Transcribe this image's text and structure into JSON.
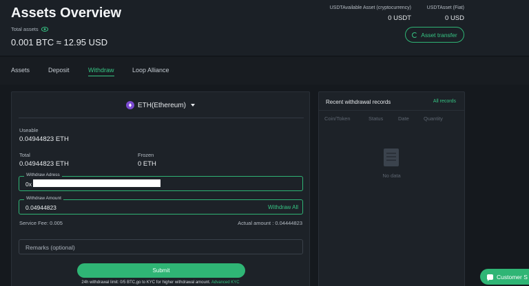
{
  "header": {
    "title": "Assets Overview",
    "total_label": "Total assets",
    "total_value": "0.001 BTC ≈ 12.95 USD",
    "crypto_label": "USDTAvailable Asset (cryptocurrency)",
    "crypto_value": "0 USDT",
    "fiat_label": "USDTAsset (Fiat)",
    "fiat_value": "0 USD",
    "transfer_label": "Asset transfer"
  },
  "tabs": [
    {
      "label": "Assets",
      "active": false
    },
    {
      "label": "Deposit",
      "active": false
    },
    {
      "label": "Withdraw",
      "active": true
    },
    {
      "label": "Loop Alliance",
      "active": false
    }
  ],
  "withdraw": {
    "coin": "ETH(Ethereum)",
    "useable_label": "Useable",
    "useable_value": "0.04944823 ETH",
    "total_label": "Total",
    "total_value": "0.04944823 ETH",
    "frozen_label": "Frozen",
    "frozen_value": "0 ETH",
    "address_label": "Withdraw Adress",
    "address_value": "0x",
    "amount_label": "Withdraw Amount",
    "amount_value": "0.04944823",
    "withdraw_all": "Withdraw All",
    "service_fee": "Service Fee:  0.005",
    "actual_amount": "Actual amount :  0.04444823",
    "remarks_placeholder": "Remarks (optional)",
    "submit_label": "Submit",
    "limit_note": "24h withdrawal limit: 0/5 BTC,go to KYC for higher withdrawal amount.",
    "kyc_link": "Advanced KYC"
  },
  "records": {
    "title": "Recent withdrawal records",
    "all_link": "All records",
    "columns": [
      "Coin/Token",
      "Status",
      "Date",
      "Quantity"
    ],
    "empty_text": "No data"
  },
  "support": {
    "label": "Customer S"
  },
  "colors": {
    "accent": "#2fb575",
    "background": "#15191e",
    "card": "#1d2228"
  }
}
